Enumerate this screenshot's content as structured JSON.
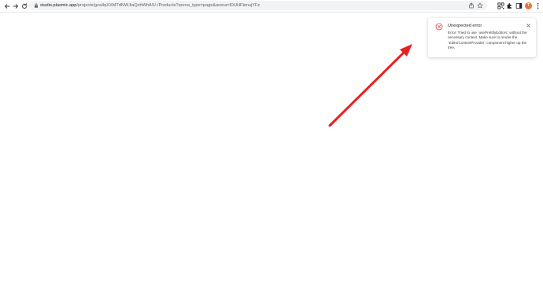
{
  "browser": {
    "url_host": "studio.plasmic.app",
    "url_path": "/projects/gza4qXXMTdNWJiaQzhWhAS/-/Products?arena_type=page&arena=lDUHFkmujYFz",
    "avatar_initial": "T",
    "icons": {
      "back": "back-arrow-icon",
      "forward": "forward-arrow-icon",
      "reload": "reload-icon",
      "lock": "lock-icon",
      "share": "share-icon",
      "bookmark": "star-icon",
      "extension_1": "qr-extension-icon",
      "extension_2": "puzzle-extension-icon",
      "side_panel": "side-panel-icon",
      "menu": "more-vert-icon"
    }
  },
  "toast": {
    "title": "Unexpected error",
    "message": "Error: Tried to use `usePrettifyEditors` without the necessary context. Make sure to render the `EditorContextProvider` component higher up the tree.",
    "icon": "error-circle-icon",
    "close_icon": "close-icon"
  },
  "colors": {
    "error_red": "#e53935",
    "arrow_red": "#e8201f",
    "avatar_orange": "#e8743b",
    "omnibox_bg": "#f1f3f4"
  }
}
